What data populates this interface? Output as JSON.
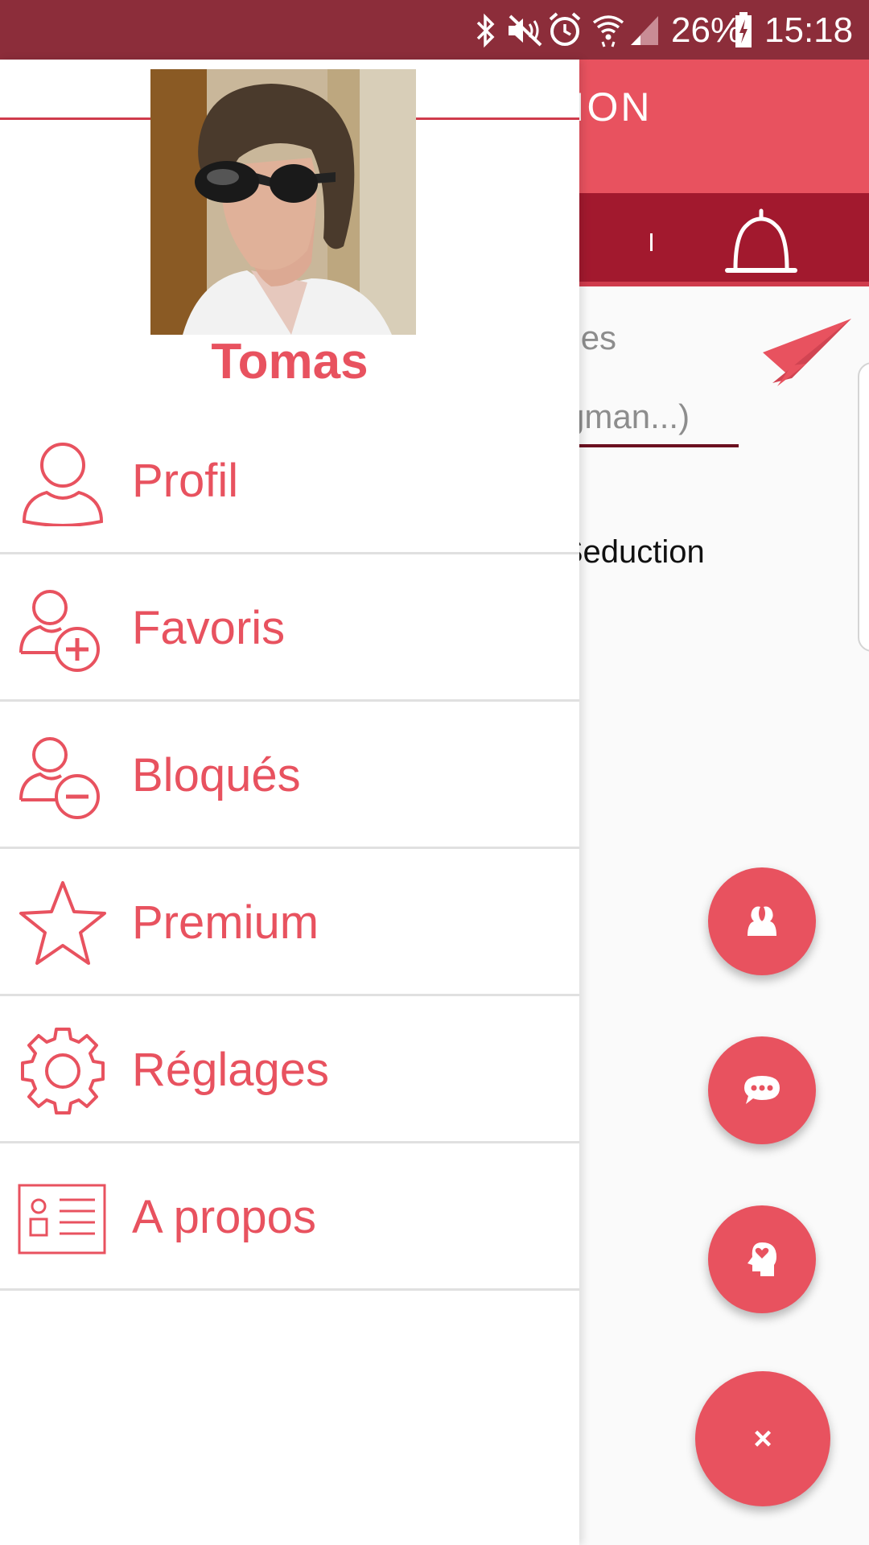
{
  "status_bar": {
    "battery": "26%",
    "time": "15:18",
    "icons": [
      "bluetooth-icon",
      "mute-icon",
      "alarm-icon",
      "wifi-icon",
      "signal-icon",
      "battery-icon"
    ]
  },
  "background_app": {
    "title_fragment": "CTION",
    "search_hint_line1": "par les",
    "search_hint_line2": "wingman...)",
    "post_text": "pp-Seduction"
  },
  "drawer": {
    "user_name": "Tomas",
    "menu_items": [
      {
        "label": "Profil",
        "icon": "profile-icon"
      },
      {
        "label": "Favoris",
        "icon": "add-user-icon"
      },
      {
        "label": "Bloqués",
        "icon": "remove-user-icon"
      },
      {
        "label": "Premium",
        "icon": "star-icon"
      },
      {
        "label": "Réglages",
        "icon": "gear-icon"
      },
      {
        "label": "A propos",
        "icon": "about-card-icon"
      }
    ]
  },
  "fabs": {
    "close_label": "×"
  },
  "colors": {
    "status_bar": "#8c2d3a",
    "accent": "#e8525f",
    "tab_bar": "#a2192e"
  }
}
